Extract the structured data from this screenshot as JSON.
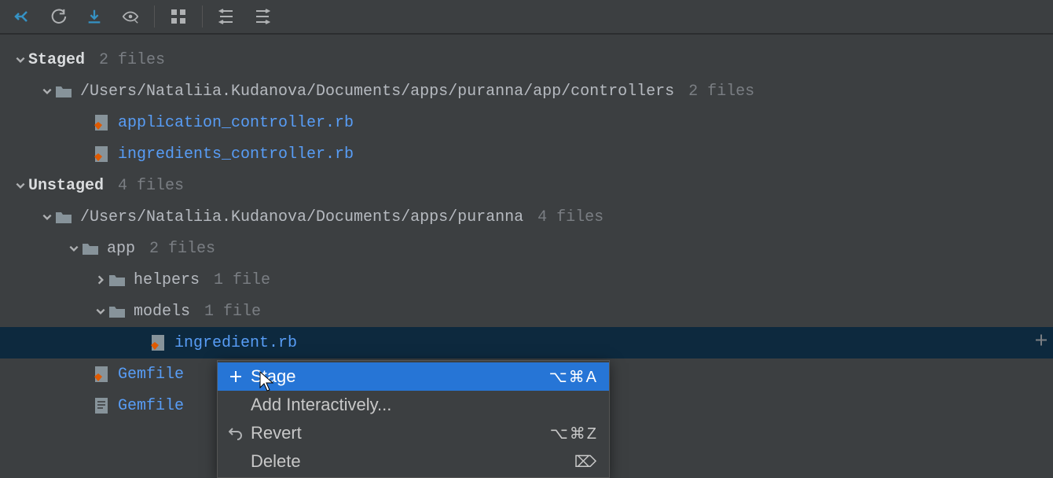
{
  "toolbar": {
    "icons": [
      "branch-merge",
      "refresh",
      "download",
      "view",
      "layout",
      "indent-left",
      "indent-right"
    ]
  },
  "tree": {
    "staged": {
      "label": "Staged",
      "count": "2 files",
      "path": "/Users/Nataliia.Kudanova/Documents/apps/puranna/app/controllers",
      "path_count": "2 files",
      "files": [
        "application_controller.rb",
        "ingredients_controller.rb"
      ]
    },
    "unstaged": {
      "label": "Unstaged",
      "count": "4 files",
      "path": "/Users/Nataliia.Kudanova/Documents/apps/puranna",
      "path_count": "4 files",
      "app": {
        "label": "app",
        "count": "2 files"
      },
      "helpers": {
        "label": "helpers",
        "count": "1 file"
      },
      "models": {
        "label": "models",
        "count": "1 file"
      },
      "models_file": "ingredient.rb",
      "gemfile": "Gemfile",
      "gemfile_lock": "Gemfile"
    }
  },
  "ctx": {
    "stage": {
      "label": "Stage",
      "shortcut": "⌥⌘A"
    },
    "add": {
      "label": "Add Interactively..."
    },
    "revert": {
      "label": "Revert",
      "shortcut": "⌥⌘Z"
    },
    "delete": {
      "label": "Delete",
      "shortcut": "⌦"
    }
  }
}
